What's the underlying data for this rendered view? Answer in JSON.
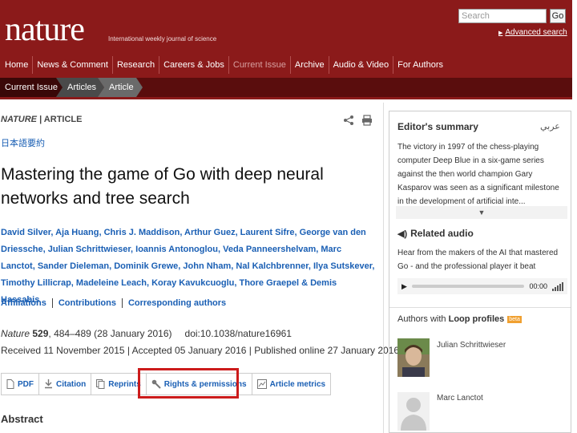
{
  "header": {
    "logo": "nature",
    "tagline": "International weekly journal of science",
    "search_placeholder": "Search",
    "go_label": "Go",
    "advanced_search": "Advanced search",
    "colors": {
      "brand": "#8b1a1a",
      "crumb_bg": "#5a0d0d",
      "link": "#1a5fb4",
      "highlight": "#cc1b1b"
    }
  },
  "nav": [
    "Home",
    "News & Comment",
    "Research",
    "Careers & Jobs",
    "Current Issue",
    "Archive",
    "Audio & Video",
    "For Authors"
  ],
  "nav_active": "Current Issue",
  "breadcrumbs": [
    "Current Issue",
    "Articles",
    "Article"
  ],
  "article": {
    "journal_name": "NATURE",
    "section": "| ARTICLE",
    "jp_link": "日本語要約",
    "title": "Mastering the game of Go with deep neural networks and tree search",
    "authors": "David Silver, Aja Huang, Chris J. Maddison, Arthur Guez, Laurent Sifre, George van den Driessche, Julian Schrittwieser, Ioannis Antonoglou, Veda Panneershelvam, Marc Lanctot, Sander Dieleman, Dominik Grewe, John Nham, Nal Kalchbrenner, Ilya Sutskever, Timothy Lillicrap, Madeleine Leach, Koray Kavukcuoglu, Thore Graepel & Demis Hassabis",
    "links": [
      "Affiliations",
      "Contributions",
      "Corresponding authors"
    ],
    "citation": {
      "journal": "Nature",
      "volume": "529",
      "pages": ", 484–489 (28 January 2016)",
      "doi": "doi:10.1038/nature16961"
    },
    "dates": "Received 11 November 2015 | Accepted 05 January 2016 | Published online 27 January 2016",
    "tools": [
      {
        "label": "PDF",
        "icon": "document-icon"
      },
      {
        "label": "Citation",
        "icon": "download-icon"
      },
      {
        "label": "Reprints",
        "icon": "reprints-icon"
      },
      {
        "label": "Rights & permissions",
        "icon": "wrench-icon"
      },
      {
        "label": "Article metrics",
        "icon": "metrics-icon"
      }
    ],
    "abstract_heading": "Abstract"
  },
  "sidebar": {
    "summary_title": "Editor's summary",
    "arabic_label": "عربي",
    "summary_text": "The victory in 1997 of the chess-playing computer Deep Blue in a six-game series against the then world champion Gary Kasparov was seen as a significant milestone in the development of artificial inte...",
    "audio_title": "Related audio",
    "audio_text": "Hear from the makers of the AI that mastered Go - and the professional player it beat",
    "audio_time": "00:00",
    "loop_title_prefix": "Authors with",
    "loop_title_bold": "Loop profiles",
    "loop_badge": "beta",
    "profiles": [
      "Julian Schrittwieser",
      "Marc Lanctot"
    ]
  }
}
